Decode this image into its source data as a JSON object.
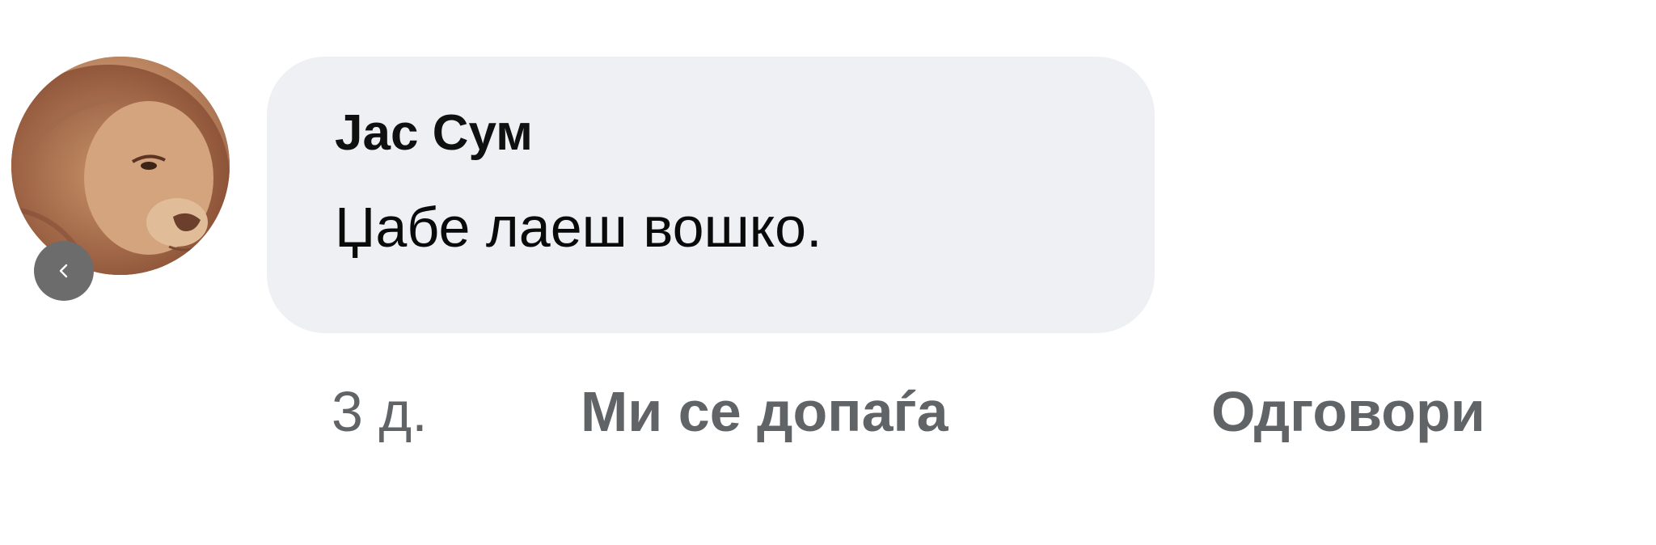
{
  "comment": {
    "author": "Јас Сум",
    "text": "Џабе лаеш вошко.",
    "avatar_icon": "lion-profile-photo"
  },
  "actions": {
    "time_ago": "3 д.",
    "like_label": "Ми се допаѓа",
    "reply_label": "Одговори"
  },
  "overlay": {
    "back_icon": "chevron-left-icon"
  },
  "colors": {
    "bubble": "#eff0f4",
    "action_text": "#616467",
    "back_button": "#6c6c6c"
  }
}
